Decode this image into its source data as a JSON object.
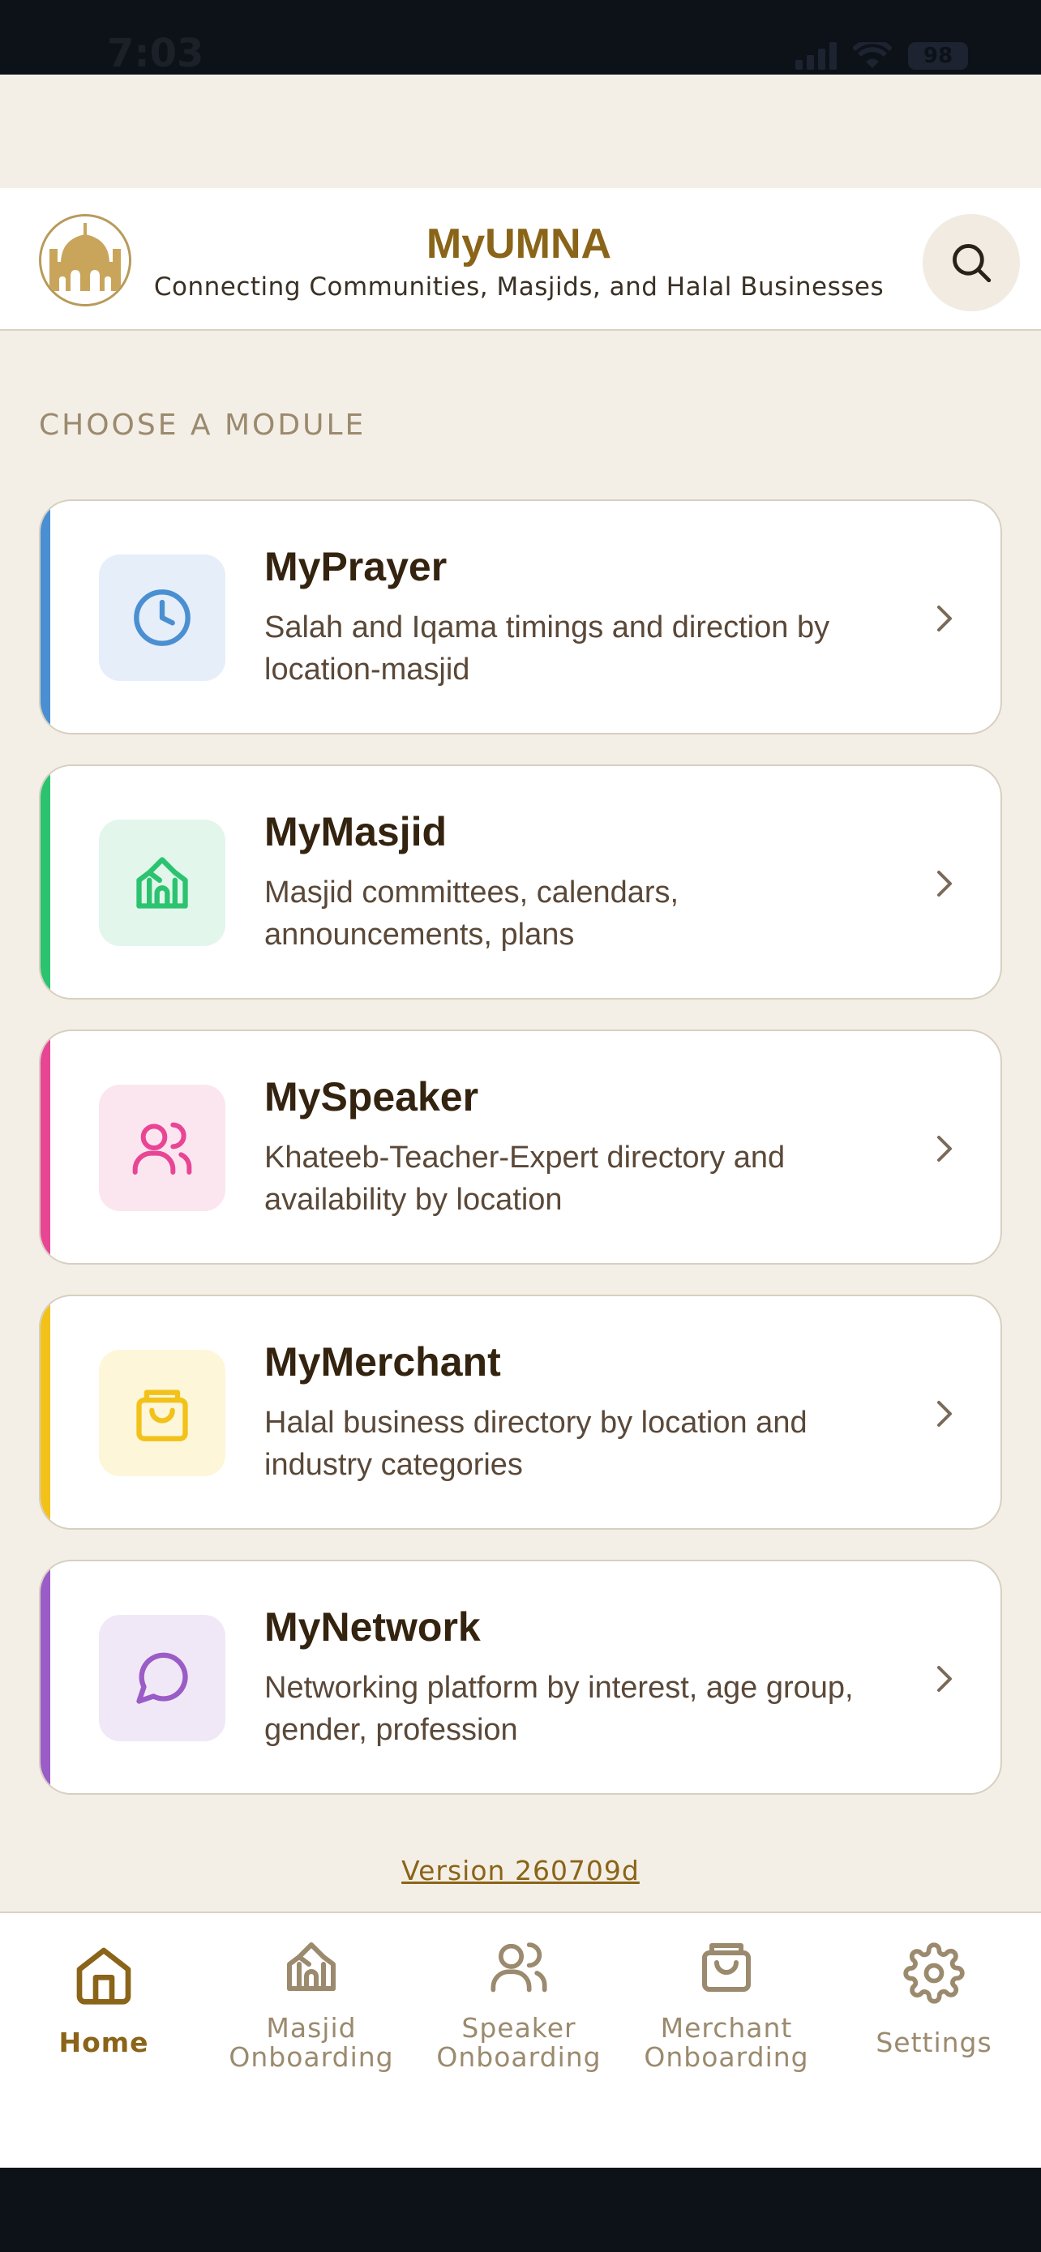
{
  "status_bar": {
    "time": "7:03",
    "battery": "98"
  },
  "header": {
    "title": "MyUMNA",
    "subtitle": "Connecting Communities, Masjids, and Halal Businesses"
  },
  "section_title": "CHOOSE A MODULE",
  "modules": [
    {
      "name": "MyPrayer",
      "desc": "Salah and Iqama timings and direction by location-masjid",
      "icon": "clock-icon",
      "accent": "#4a8fd1",
      "tile": "#e6eefa"
    },
    {
      "name": "MyMasjid",
      "desc": "Masjid committees, calendars, announcements, plans",
      "icon": "mosque-icon",
      "accent": "#2bc36f",
      "tile": "#e2f6ec"
    },
    {
      "name": "MySpeaker",
      "desc": "Khateeb-Teacher-Expert directory and availability by location",
      "icon": "users-icon",
      "accent": "#e94595",
      "tile": "#fbe6f0"
    },
    {
      "name": "MyMerchant",
      "desc": "Halal business directory by location and industry categories",
      "icon": "shopping-bag-icon",
      "accent": "#f2c21a",
      "tile": "#fdf6d8"
    },
    {
      "name": "MyNetwork",
      "desc": "Networking platform by interest, age group, gender, profession",
      "icon": "chat-bubble-icon",
      "accent": "#9a5cc6",
      "tile": "#f1e8f7"
    }
  ],
  "version": "Version 260709d",
  "tabs": [
    {
      "label_1": "Home",
      "label_2": "",
      "icon": "home-icon",
      "active": true
    },
    {
      "label_1": "Masjid",
      "label_2": "Onboarding",
      "icon": "mosque-icon"
    },
    {
      "label_1": "Speaker",
      "label_2": "Onboarding",
      "icon": "users-icon"
    },
    {
      "label_1": "Merchant",
      "label_2": "Onboarding",
      "icon": "shopping-bag-icon"
    },
    {
      "label_1": "Settings",
      "label_2": "",
      "icon": "gear-icon"
    }
  ],
  "colors": {
    "brand": "#8a6418",
    "background": "#f4efe6",
    "muted": "#9b8a6e"
  }
}
